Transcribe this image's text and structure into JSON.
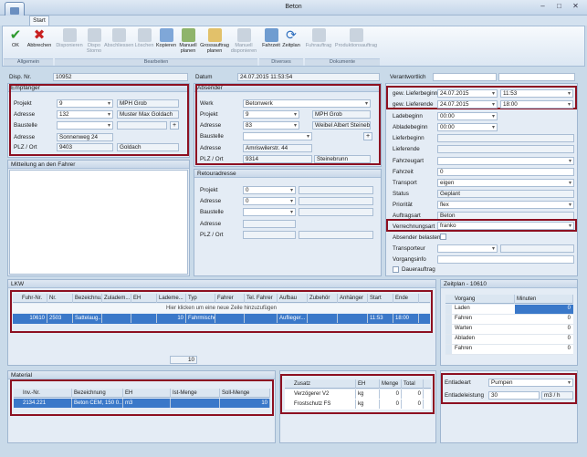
{
  "window": {
    "title": "Beton"
  },
  "ribbon": {
    "tab": "Start",
    "buttons": {
      "ok": "OK",
      "abbrechen": "Abbrechen",
      "disponieren": "Disponieren",
      "dispo_storno": "Dispo Storno",
      "abschliessen": "Abschliessen",
      "loeschen": "Löschen",
      "kopieren": "Kopieren",
      "manuell_planen": "Manuell planen",
      "grossauftrag": "Grossauftrag planen",
      "manuell_disponieren": "Manuell disponieren",
      "fahrzeit": "Fahrzeit",
      "zeitplan": "Zeitplan",
      "fuhrauftrag": "Fuhrauftrag",
      "produktionsauftrag": "Produktionsauftrag"
    },
    "groups": {
      "allgemein": "Allgemein",
      "bearbeiten": "Bearbeiten",
      "diverses": "Diverses",
      "dokumente": "Dokumente"
    }
  },
  "header": {
    "disp_nr_label": "Disp. Nr.",
    "disp_nr": "10952",
    "datum_label": "Datum",
    "datum": "24.07.2015 11:53:54",
    "verantwortlich_label": "Verantwortlich"
  },
  "empfaenger": {
    "title": "Empfänger",
    "projekt_label": "Projekt",
    "projekt": "9",
    "projekt_name": "MPH Grob",
    "adresse_label": "Adresse",
    "adresse": "132",
    "adresse_name": "Muster Max Goldach",
    "baustelle_label": "Baustelle",
    "adresse2_label": "Adresse",
    "adresse2": "Sonnenweg 24",
    "plz_label": "PLZ / Ort",
    "plz": "9403",
    "ort": "Goldach"
  },
  "mitteilung": {
    "title": "Mitteilung an den Fahrer"
  },
  "absender": {
    "title": "Absender",
    "werk_label": "Werk",
    "werk": "Betonwerk",
    "projekt_label": "Projekt",
    "projekt": "9",
    "projekt_name": "MPH Grob",
    "adresse_label": "Adresse",
    "adresse": "83",
    "adresse_name": "Weibel Albert Steinebrunn",
    "baustelle_label": "Baustelle",
    "adresse2_label": "Adresse",
    "adresse2": "Amriswilerstr. 44",
    "plz_label": "PLZ / Ort",
    "plz": "9314",
    "ort": "Steinebrunn"
  },
  "retouradresse": {
    "title": "Retouradresse",
    "projekt_label": "Projekt",
    "projekt": "0",
    "adresse_label": "Adresse",
    "adresse": "0",
    "baustelle_label": "Baustelle",
    "adresse2_label": "Adresse",
    "plz_label": "PLZ / Ort"
  },
  "rightpanel": {
    "lieferbeginn_label": "gew. Lieferbeginn",
    "lieferbeginn_date": "24.07.2015",
    "lieferbeginn_time": "11:53",
    "lieferende_label": "gew. Lieferende",
    "lieferende_date": "24.07.2015",
    "lieferende_time": "18:00",
    "ladebeginn_label": "Ladebeginn",
    "ladebeginn": "00:00",
    "abladebeginn_label": "Abladebeginn",
    "abladebeginn": "00:00",
    "lieferbeginn2_label": "Lieferbeginn",
    "lieferende2_label": "Lieferende",
    "fahrzeugart_label": "Fahrzeugart",
    "fahrzeit_label": "Fahrzeit",
    "fahrzeit": "0",
    "transport_label": "Transport",
    "transport": "eigen",
    "status_label": "Status",
    "status": "Geplant",
    "prioritaet_label": "Priorität",
    "prioritaet": "flex",
    "auftragsart_label": "Auftragsart",
    "auftragsart": "Beton",
    "verrechnungsart_label": "Verrechnungsart",
    "verrechnungsart": "franko",
    "absender_belasten_label": "Absender belasten",
    "transporteur_label": "Transporteur",
    "vorgangsinfo_label": "Vorgangsinfo",
    "dauerauftrag_label": "Dauerauftrag"
  },
  "lkw": {
    "title": "LKW",
    "columns": [
      "Fuhr-Nr.",
      "Nr.",
      "Bezeichnu...",
      "Zuladem...",
      "EH",
      "Lademe...",
      "Typ",
      "Fahrer",
      "Tel. Fahrer",
      "Aufbau",
      "Zubehör",
      "Anhänger",
      "Start",
      "Ende"
    ],
    "new_row_hint": "Hier klicken um eine neue Zeile hinzuzufügen",
    "row": [
      "10610",
      "2503",
      "Sattelaug...",
      "",
      "",
      "10",
      "Fahrmischer",
      "",
      "",
      "Auflieger...",
      "",
      "",
      "11:53",
      "18:00"
    ],
    "total": "10"
  },
  "zeitplan": {
    "title": "Zeitplan - 10610",
    "columns": [
      "Vorgang",
      "Minuten"
    ],
    "rows": [
      {
        "vorgang": "Laden",
        "minuten": "0"
      },
      {
        "vorgang": "Fahren",
        "minuten": "0"
      },
      {
        "vorgang": "Warten",
        "minuten": "0"
      },
      {
        "vorgang": "Abladen",
        "minuten": "0"
      },
      {
        "vorgang": "Fahren",
        "minuten": "0"
      }
    ]
  },
  "material": {
    "title": "Material",
    "columns": [
      "Inv.-Nr.",
      "Bezeichnung",
      "EH",
      "Ist-Menge",
      "Soll-Menge"
    ],
    "row": [
      "2134.221",
      "Beton CEM, 150 0....",
      "m3",
      "",
      "10"
    ]
  },
  "zusatz": {
    "columns": [
      "Zusatz",
      "EH",
      "Menge",
      "Total"
    ],
    "rows": [
      {
        "name": "Verzögerer V2",
        "eh": "kg",
        "menge": "0",
        "total": "0"
      },
      {
        "name": "Frostschutz FS",
        "eh": "kg",
        "menge": "0",
        "total": "0"
      }
    ]
  },
  "entlade": {
    "entladeart_label": "Entladeart",
    "entladeart": "Pumpen",
    "entladeleistung_label": "Entladeleistung",
    "entladeleistung": "30",
    "unit": "m3 / h"
  },
  "colors": {
    "redbox": "#8d1021",
    "selection": "#3a78c9"
  }
}
